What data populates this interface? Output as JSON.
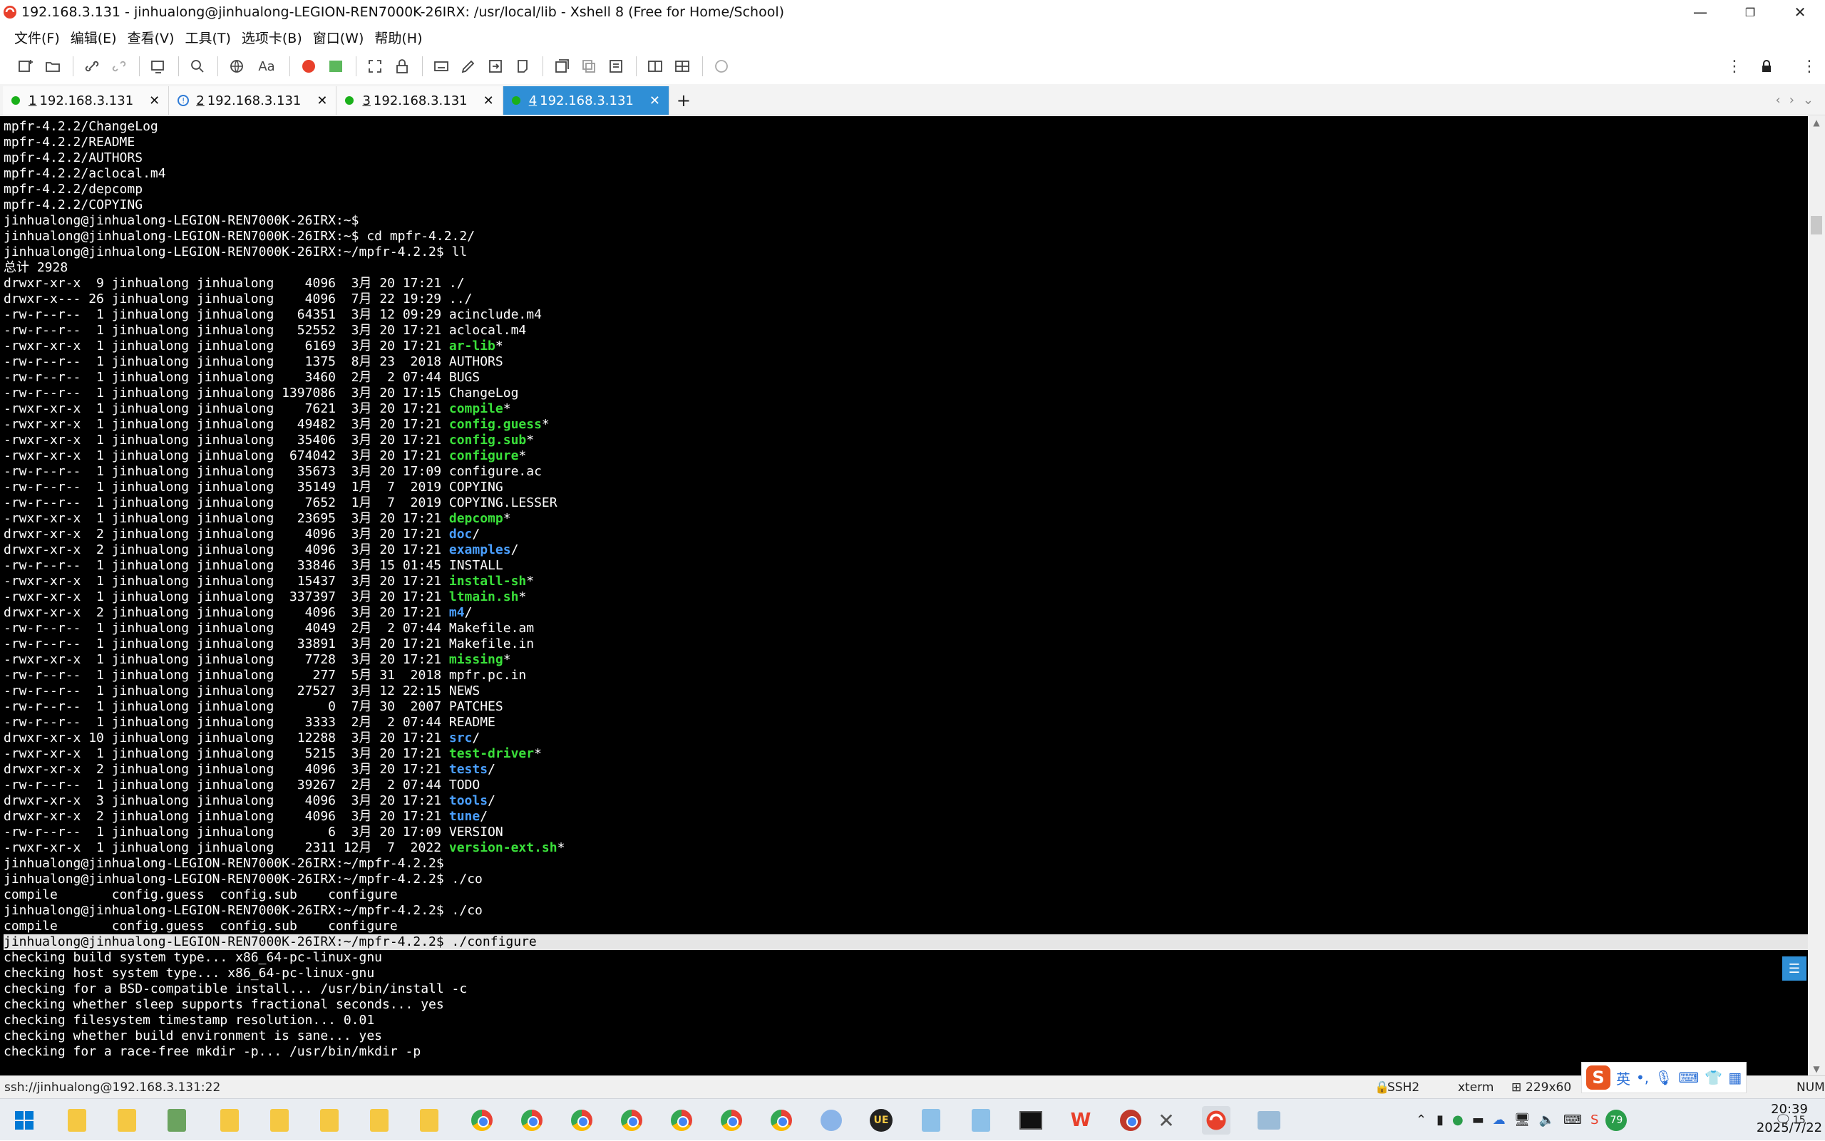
{
  "window": {
    "title": "192.168.3.131 - jinhualong@jinhualong-LEGION-REN7000K-26IRX: /usr/local/lib - Xshell 8 (Free for Home/School)",
    "minimize": "—",
    "maximize": "❐",
    "close": "✕"
  },
  "menu": [
    "文件(F)",
    "编辑(E)",
    "查看(V)",
    "工具(T)",
    "选项卡(B)",
    "窗口(W)",
    "帮助(H)"
  ],
  "tabs": [
    {
      "num": "1",
      "label": "192.168.3.131",
      "status": "connected",
      "close": "✕"
    },
    {
      "num": "2",
      "label": "192.168.3.131",
      "status": "warning",
      "close": "✕"
    },
    {
      "num": "3",
      "label": "192.168.3.131",
      "status": "connected",
      "close": "✕"
    },
    {
      "num": "4",
      "label": "192.168.3.131",
      "status": "active",
      "close": "✕"
    }
  ],
  "tab_add": "+",
  "terminal": {
    "lines": [
      {
        "t": "mpfr-4.2.2/ChangeLog"
      },
      {
        "t": "mpfr-4.2.2/README"
      },
      {
        "t": "mpfr-4.2.2/AUTHORS"
      },
      {
        "t": "mpfr-4.2.2/aclocal.m4"
      },
      {
        "t": "mpfr-4.2.2/depcomp"
      },
      {
        "t": "mpfr-4.2.2/COPYING"
      },
      {
        "t": "jinhualong@jinhualong-LEGION-REN7000K-26IRX:~$"
      },
      {
        "t": "jinhualong@jinhualong-LEGION-REN7000K-26IRX:~$ cd mpfr-4.2.2/"
      },
      {
        "t": "jinhualong@jinhualong-LEGION-REN7000K-26IRX:~/mpfr-4.2.2$ ll"
      },
      {
        "t": "总计 2928"
      },
      {
        "t": "drwxr-xr-x  9 jinhualong jinhualong    4096  3月 20 17:21 ",
        "n": "./",
        "c": ""
      },
      {
        "t": "drwxr-x--- 26 jinhualong jinhualong    4096  7月 22 19:29 ",
        "n": "../",
        "c": ""
      },
      {
        "t": "-rw-r--r--  1 jinhualong jinhualong   64351  3月 12 09:29 ",
        "n": "acinclude.m4",
        "c": ""
      },
      {
        "t": "-rw-r--r--  1 jinhualong jinhualong   52552  3月 20 17:21 ",
        "n": "aclocal.m4",
        "c": ""
      },
      {
        "t": "-rwxr-xr-x  1 jinhualong jinhualong    6169  3月 20 17:21 ",
        "n": "ar-lib",
        "c": "green",
        "s": "*"
      },
      {
        "t": "-rw-r--r--  1 jinhualong jinhualong    1375  8月 23  2018 ",
        "n": "AUTHORS",
        "c": ""
      },
      {
        "t": "-rw-r--r--  1 jinhualong jinhualong    3460  2月  2 07:44 ",
        "n": "BUGS",
        "c": ""
      },
      {
        "t": "-rw-r--r--  1 jinhualong jinhualong 1397086  3月 20 17:15 ",
        "n": "ChangeLog",
        "c": ""
      },
      {
        "t": "-rwxr-xr-x  1 jinhualong jinhualong    7621  3月 20 17:21 ",
        "n": "compile",
        "c": "green",
        "s": "*"
      },
      {
        "t": "-rwxr-xr-x  1 jinhualong jinhualong   49482  3月 20 17:21 ",
        "n": "config.guess",
        "c": "green",
        "s": "*"
      },
      {
        "t": "-rwxr-xr-x  1 jinhualong jinhualong   35406  3月 20 17:21 ",
        "n": "config.sub",
        "c": "green",
        "s": "*"
      },
      {
        "t": "-rwxr-xr-x  1 jinhualong jinhualong  674042  3月 20 17:21 ",
        "n": "configure",
        "c": "green",
        "s": "*"
      },
      {
        "t": "-rw-r--r--  1 jinhualong jinhualong   35673  3月 20 17:09 ",
        "n": "configure.ac",
        "c": ""
      },
      {
        "t": "-rw-r--r--  1 jinhualong jinhualong   35149  1月  7  2019 ",
        "n": "COPYING",
        "c": ""
      },
      {
        "t": "-rw-r--r--  1 jinhualong jinhualong    7652  1月  7  2019 ",
        "n": "COPYING.LESSER",
        "c": ""
      },
      {
        "t": "-rwxr-xr-x  1 jinhualong jinhualong   23695  3月 20 17:21 ",
        "n": "depcomp",
        "c": "green",
        "s": "*"
      },
      {
        "t": "drwxr-xr-x  2 jinhualong jinhualong    4096  3月 20 17:21 ",
        "n": "doc",
        "c": "blue",
        "s": "/"
      },
      {
        "t": "drwxr-xr-x  2 jinhualong jinhualong    4096  3月 20 17:21 ",
        "n": "examples",
        "c": "blue",
        "s": "/"
      },
      {
        "t": "-rw-r--r--  1 jinhualong jinhualong   33846  3月 15 01:45 ",
        "n": "INSTALL",
        "c": ""
      },
      {
        "t": "-rwxr-xr-x  1 jinhualong jinhualong   15437  3月 20 17:21 ",
        "n": "install-sh",
        "c": "green",
        "s": "*"
      },
      {
        "t": "-rwxr-xr-x  1 jinhualong jinhualong  337397  3月 20 17:21 ",
        "n": "ltmain.sh",
        "c": "green",
        "s": "*"
      },
      {
        "t": "drwxr-xr-x  2 jinhualong jinhualong    4096  3月 20 17:21 ",
        "n": "m4",
        "c": "blue",
        "s": "/"
      },
      {
        "t": "-rw-r--r--  1 jinhualong jinhualong    4049  2月  2 07:44 ",
        "n": "Makefile.am",
        "c": ""
      },
      {
        "t": "-rw-r--r--  1 jinhualong jinhualong   33891  3月 20 17:21 ",
        "n": "Makefile.in",
        "c": ""
      },
      {
        "t": "-rwxr-xr-x  1 jinhualong jinhualong    7728  3月 20 17:21 ",
        "n": "missing",
        "c": "green",
        "s": "*"
      },
      {
        "t": "-rw-r--r--  1 jinhualong jinhualong     277  5月 31  2018 ",
        "n": "mpfr.pc.in",
        "c": ""
      },
      {
        "t": "-rw-r--r--  1 jinhualong jinhualong   27527  3月 12 22:15 ",
        "n": "NEWS",
        "c": ""
      },
      {
        "t": "-rw-r--r--  1 jinhualong jinhualong       0  7月 30  2007 ",
        "n": "PATCHES",
        "c": ""
      },
      {
        "t": "-rw-r--r--  1 jinhualong jinhualong    3333  2月  2 07:44 ",
        "n": "README",
        "c": ""
      },
      {
        "t": "drwxr-xr-x 10 jinhualong jinhualong   12288  3月 20 17:21 ",
        "n": "src",
        "c": "blue",
        "s": "/"
      },
      {
        "t": "-rwxr-xr-x  1 jinhualong jinhualong    5215  3月 20 17:21 ",
        "n": "test-driver",
        "c": "green",
        "s": "*"
      },
      {
        "t": "drwxr-xr-x  2 jinhualong jinhualong    4096  3月 20 17:21 ",
        "n": "tests",
        "c": "blue",
        "s": "/"
      },
      {
        "t": "-rw-r--r--  1 jinhualong jinhualong   39267  2月  2 07:44 ",
        "n": "TODO",
        "c": ""
      },
      {
        "t": "drwxr-xr-x  3 jinhualong jinhualong    4096  3月 20 17:21 ",
        "n": "tools",
        "c": "blue",
        "s": "/"
      },
      {
        "t": "drwxr-xr-x  2 jinhualong jinhualong    4096  3月 20 17:21 ",
        "n": "tune",
        "c": "blue",
        "s": "/"
      },
      {
        "t": "-rw-r--r--  1 jinhualong jinhualong       6  3月 20 17:09 ",
        "n": "VERSION",
        "c": ""
      },
      {
        "t": "-rwxr-xr-x  1 jinhualong jinhualong    2311 12月  7  2022 ",
        "n": "version-ext.sh",
        "c": "green",
        "s": "*"
      },
      {
        "t": "jinhualong@jinhualong-LEGION-REN7000K-26IRX:~/mpfr-4.2.2$"
      },
      {
        "t": "jinhualong@jinhualong-LEGION-REN7000K-26IRX:~/mpfr-4.2.2$ ./co"
      },
      {
        "t": "compile       config.guess  config.sub    configure"
      },
      {
        "t": "jinhualong@jinhualong-LEGION-REN7000K-26IRX:~/mpfr-4.2.2$ ./co"
      },
      {
        "t": "compile       config.guess  config.sub    configure"
      },
      {
        "t": "jinhualong@jinhualong-LEGION-REN7000K-26IRX:~/mpfr-4.2.2$ ./configure",
        "hl": true
      },
      {
        "t": "checking build system type... x86_64-pc-linux-gnu"
      },
      {
        "t": "checking host system type... x86_64-pc-linux-gnu"
      },
      {
        "t": "checking for a BSD-compatible install... /usr/bin/install -c"
      },
      {
        "t": "checking whether sleep supports fractional seconds... yes"
      },
      {
        "t": "checking filesystem timestamp resolution... 0.01"
      },
      {
        "t": "checking whether build environment is sane... yes"
      },
      {
        "t": "checking for a race-free mkdir -p... /usr/bin/mkdir -p"
      }
    ]
  },
  "status": {
    "connection": "ssh://jinhualong@192.168.3.131:22",
    "protocol": "SSH2",
    "term": "xterm",
    "size": "229x60",
    "num": "NUM"
  },
  "ime": {
    "logo": "S",
    "lang": "英"
  },
  "clock": {
    "time": "20:39",
    "date": "2025/7/22"
  },
  "taskbar": {
    "notif_count": "15",
    "battery": "79"
  },
  "colors": {
    "accent": "#2f8fd6",
    "terminal_bg": "#000000",
    "exec_green": "#3ae03a",
    "dir_blue": "#4a9fff"
  }
}
